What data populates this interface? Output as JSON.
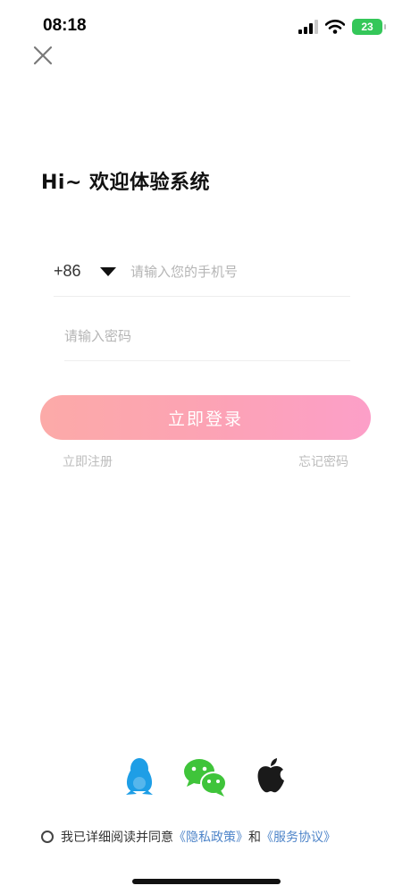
{
  "status_bar": {
    "time": "08:18",
    "battery_level": "23",
    "signal_icon": "cellular-signal-icon",
    "wifi_icon": "wifi-icon",
    "battery_color": "#34c759"
  },
  "header": {
    "close_icon": "close-icon",
    "title": "Hi~ 欢迎体验系统"
  },
  "form": {
    "country_code": "+86",
    "country_caret_icon": "caret-down-icon",
    "phone_placeholder": "请输入您的手机号",
    "phone_value": "",
    "password_placeholder": "请输入密码",
    "password_value": ""
  },
  "actions": {
    "login_label": "立即登录",
    "register_label": "立即注册",
    "forgot_label": "忘记密码",
    "login_gradient": [
      "#fcaaa8",
      "#fc9fc8"
    ]
  },
  "social_login": [
    {
      "icon": "qq-icon",
      "color": "#1e9ee6"
    },
    {
      "icon": "wechat-icon",
      "color": "#3fc43a"
    },
    {
      "icon": "apple-icon",
      "color": "#1a1a1a"
    }
  ],
  "agreement": {
    "prefix": "我已详细阅读并同意",
    "privacy_link": "《隐私政策》",
    "conjunction": "和",
    "service_link": "《服务协议》",
    "link_color": "#4f85c9"
  }
}
